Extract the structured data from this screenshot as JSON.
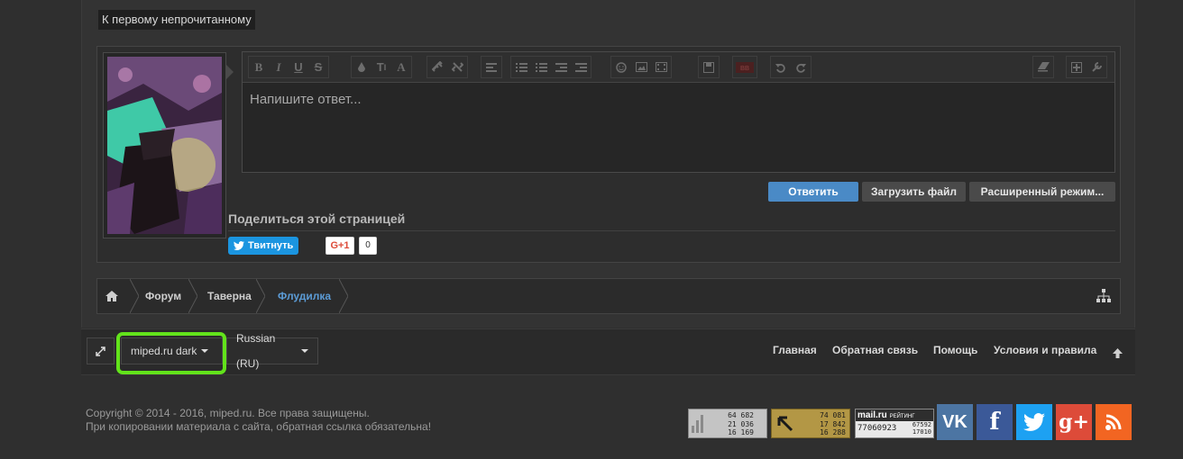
{
  "unread_link": "К первому непрочитанному",
  "editor": {
    "placeholder": "Напишите ответ...",
    "toolbar_icons": [
      "bold-icon",
      "italic-icon",
      "underline-icon",
      "strikethrough-icon",
      "color-icon",
      "font-size-icon",
      "font-icon",
      "link-icon",
      "unlink-icon",
      "align-icon",
      "bullet-list-icon",
      "numbered-list-icon",
      "outdent-icon",
      "indent-icon",
      "smilie-icon",
      "image-icon",
      "media-icon",
      "save-draft-icon",
      "bbcode-icon",
      "undo-icon",
      "redo-icon",
      "remove-format-icon",
      "insert-icon",
      "settings-icon"
    ]
  },
  "actions": {
    "reply": "Ответить",
    "upload": "Загрузить файл",
    "advanced": "Расширенный режим..."
  },
  "share": {
    "title": "Поделиться этой страницей",
    "tweet": "Твитнуть",
    "gplus": "G+1",
    "gplus_count": "0"
  },
  "breadcrumb": {
    "items": [
      "Форум",
      "Таверна",
      "Флудилка"
    ]
  },
  "footer": {
    "style_chooser": "miped.ru dark",
    "language_chooser": "Russian (RU)",
    "links": [
      "Главная",
      "Обратная связь",
      "Помощь",
      "Условия и правила"
    ]
  },
  "copyright": {
    "line1": "Copyright © 2014 - 2016, miped.ru. Все права защищены.",
    "line2": "При копировании материала с сайта, обратная ссылка обязательна!"
  },
  "counters": {
    "liveinternet": [
      "64 682",
      "21 036",
      "16 169"
    ],
    "second": [
      "74 081",
      "17 842",
      "16 288"
    ],
    "mailru_label": "mail.ru",
    "mailru_sub": "РЕЙТИНГ",
    "mailru_id": "77060923",
    "mailru_values": [
      "67592",
      "17010"
    ]
  },
  "social": {
    "vk": "VK",
    "facebook": "f",
    "gplus": "g+"
  },
  "colors": {
    "accent": "#4a8ac6",
    "highlight": "#62e31b",
    "vk": "#4c75a3",
    "facebook": "#3b5998",
    "twitter": "#1da1f2",
    "gplus": "#dd4b39",
    "rss": "#f26522"
  }
}
